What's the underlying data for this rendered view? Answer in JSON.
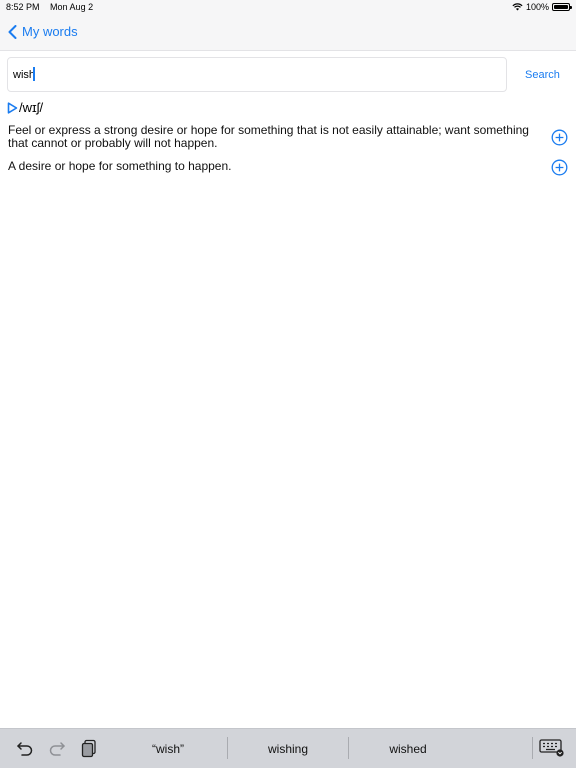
{
  "status": {
    "time": "8:52 PM",
    "date": "Mon Aug 2",
    "battery": "100%"
  },
  "nav": {
    "back_label": "My words"
  },
  "search": {
    "value": "wish",
    "button_label": "Search"
  },
  "entry": {
    "pronunciation": "/wɪʃ/",
    "definitions": [
      "Feel or express a strong desire or hope for something that is not easily attainable; want something that cannot or probably will not happen.",
      "A desire or hope for something to happen."
    ]
  },
  "keyboard": {
    "suggestions": [
      "“wish”",
      "wishing",
      "wished"
    ]
  },
  "colors": {
    "accent": "#1a7cf0",
    "keyboard_bar": "#d2d4d9",
    "bar_background": "#f6f6f7"
  }
}
